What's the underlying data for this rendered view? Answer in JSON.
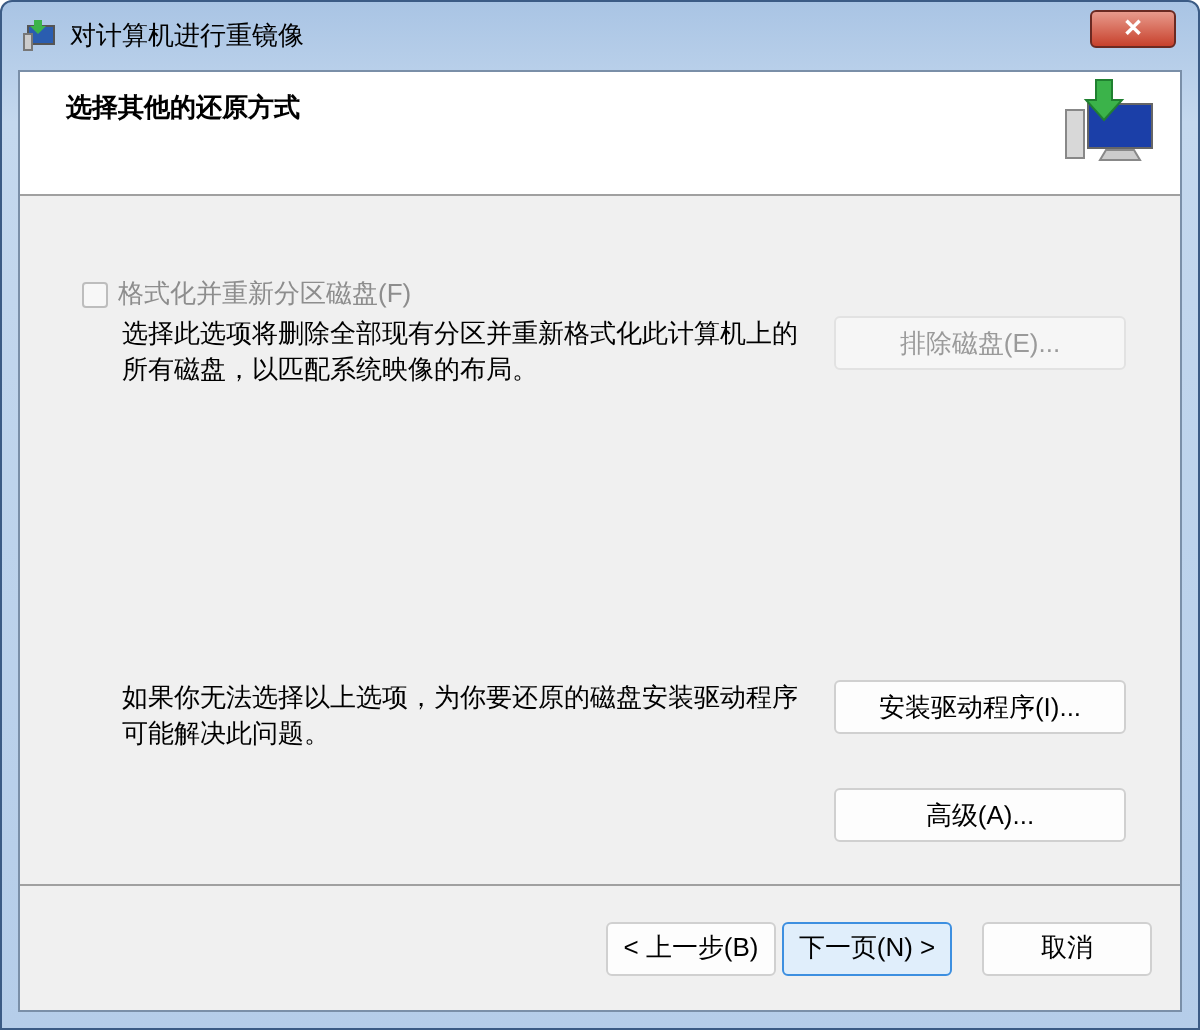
{
  "window": {
    "title": "对计算机进行重镜像",
    "close": "✕"
  },
  "header": {
    "title": "选择其他的还原方式"
  },
  "format_option": {
    "label": "格式化并重新分区磁盘(F)",
    "checked": false,
    "disabled": true,
    "description": "选择此选项将删除全部现有分区并重新格式化此计算机上的所有磁盘，以匹配系统映像的布局。",
    "button": {
      "label": "排除磁盘(E)...",
      "disabled": true
    }
  },
  "driver_option": {
    "description": "如果你无法选择以上选项，为你要还原的磁盘安装驱动程序可能解决此问题。",
    "button": {
      "label": "安装驱动程序(I)...",
      "disabled": false
    }
  },
  "advanced_button": {
    "label": "高级(A)...",
    "disabled": false
  },
  "buttons": [
    {
      "label": "< 上一步(B)",
      "highlighted": false
    },
    {
      "label": "下一页(N) >",
      "highlighted": true
    },
    {
      "label": "取消",
      "highlighted": false
    }
  ]
}
